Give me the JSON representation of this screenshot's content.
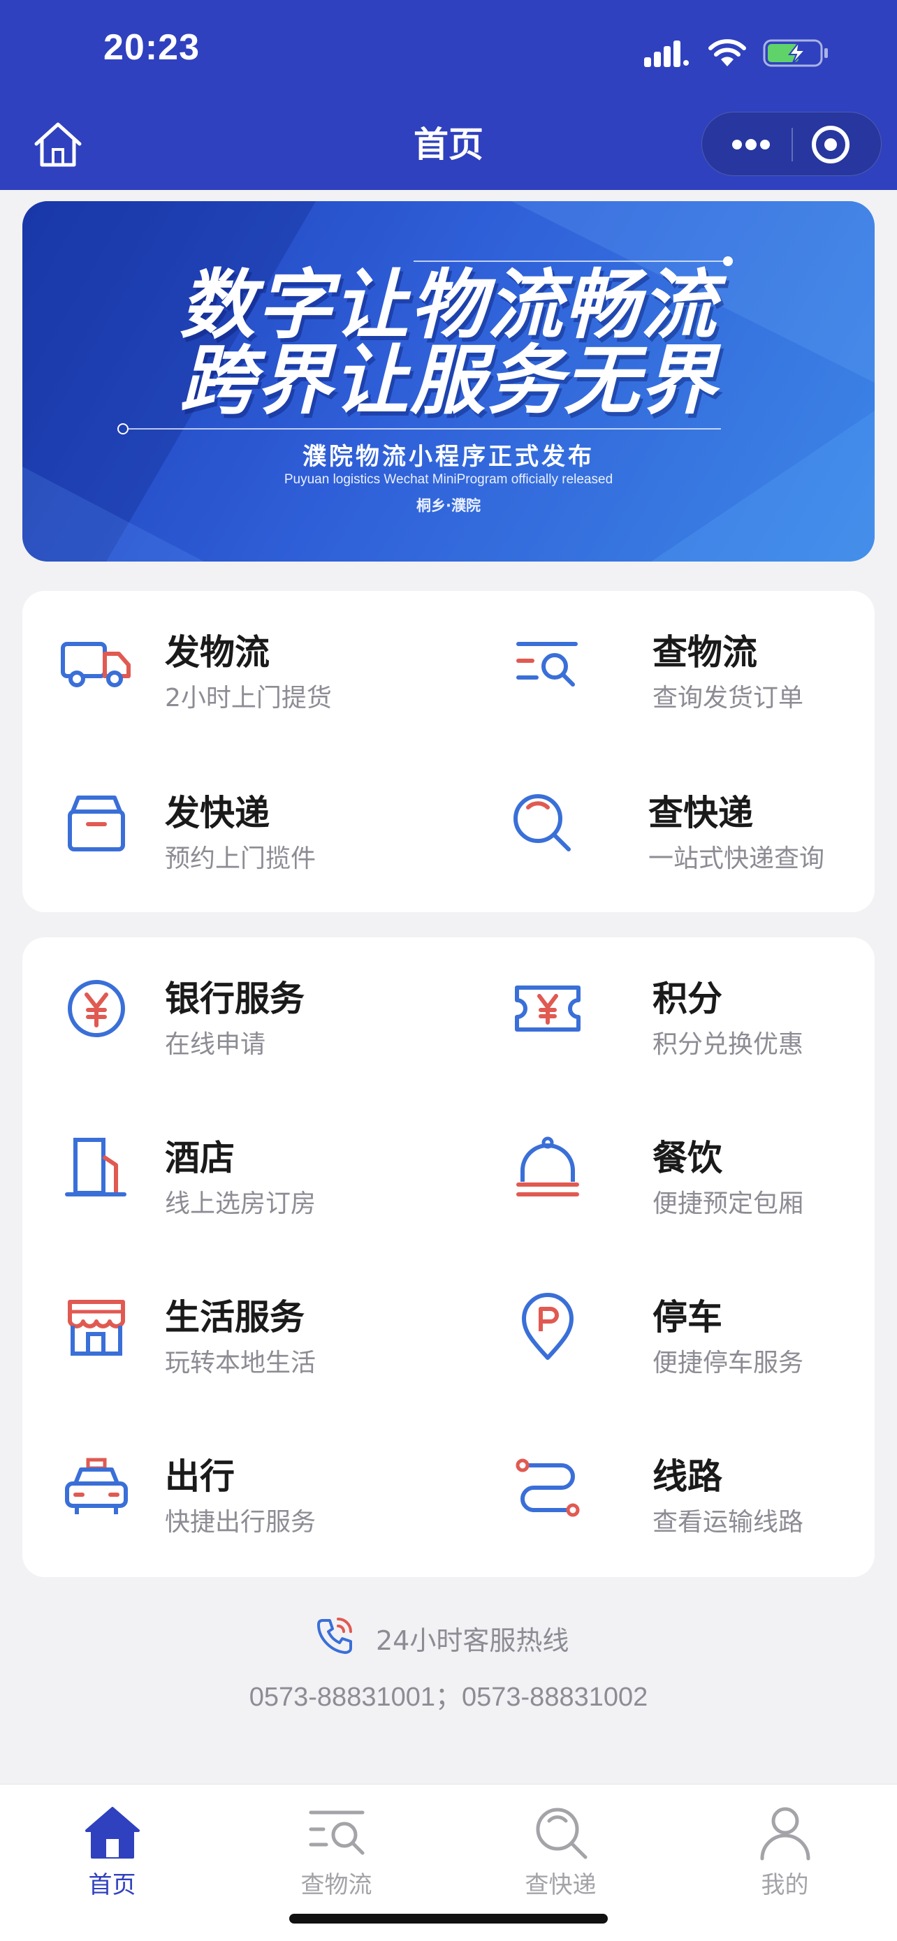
{
  "status_bar": {
    "time": "20:23"
  },
  "nav": {
    "title": "首页"
  },
  "banner": {
    "headline_1": "数字让物流畅流",
    "headline_2": "跨界让服务无界",
    "subtitle": "濮院物流小程序正式发布",
    "subtitle_en": "Puyuan logistics Wechat MiniProgram officially released",
    "location": "桐乡·濮院"
  },
  "logistics_services": [
    {
      "title": "发物流",
      "desc": "2小时上门提货",
      "icon": "truck-icon"
    },
    {
      "title": "查物流",
      "desc": "查询发货订单",
      "icon": "search-list-icon"
    },
    {
      "title": "发快递",
      "desc": "预约上门揽件",
      "icon": "box-icon"
    },
    {
      "title": "查快递",
      "desc": "一站式快递查询",
      "icon": "magnifier-icon"
    }
  ],
  "life_services": [
    {
      "title": "银行服务",
      "desc": "在线申请",
      "icon": "yuan-coin-icon"
    },
    {
      "title": "积分",
      "desc": "积分兑换优惠",
      "icon": "yuan-ticket-icon"
    },
    {
      "title": "酒店",
      "desc": "线上选房订房",
      "icon": "building-icon"
    },
    {
      "title": "餐饮",
      "desc": "便捷预定包厢",
      "icon": "cloche-icon"
    },
    {
      "title": "生活服务",
      "desc": "玩转本地生活",
      "icon": "shop-icon"
    },
    {
      "title": "停车",
      "desc": "便捷停车服务",
      "icon": "parking-pin-icon"
    },
    {
      "title": "出行",
      "desc": "快捷出行服务",
      "icon": "taxi-icon"
    },
    {
      "title": "线路",
      "desc": "查看运输线路",
      "icon": "route-icon"
    }
  ],
  "hotline": {
    "label": "24小时客服热线",
    "numbers": "0573-88831001；0573-88831002"
  },
  "tabbar": [
    {
      "label": "首页",
      "icon": "home-icon",
      "active": true
    },
    {
      "label": "查物流",
      "icon": "search-list-icon",
      "active": false
    },
    {
      "label": "查快递",
      "icon": "magnifier-icon",
      "active": false
    },
    {
      "label": "我的",
      "icon": "user-icon",
      "active": false
    }
  ],
  "colors": {
    "brand": "#2f41be",
    "icon_blue": "#3a6fd8",
    "icon_red": "#e05a52",
    "muted_text": "#8c8c94"
  }
}
